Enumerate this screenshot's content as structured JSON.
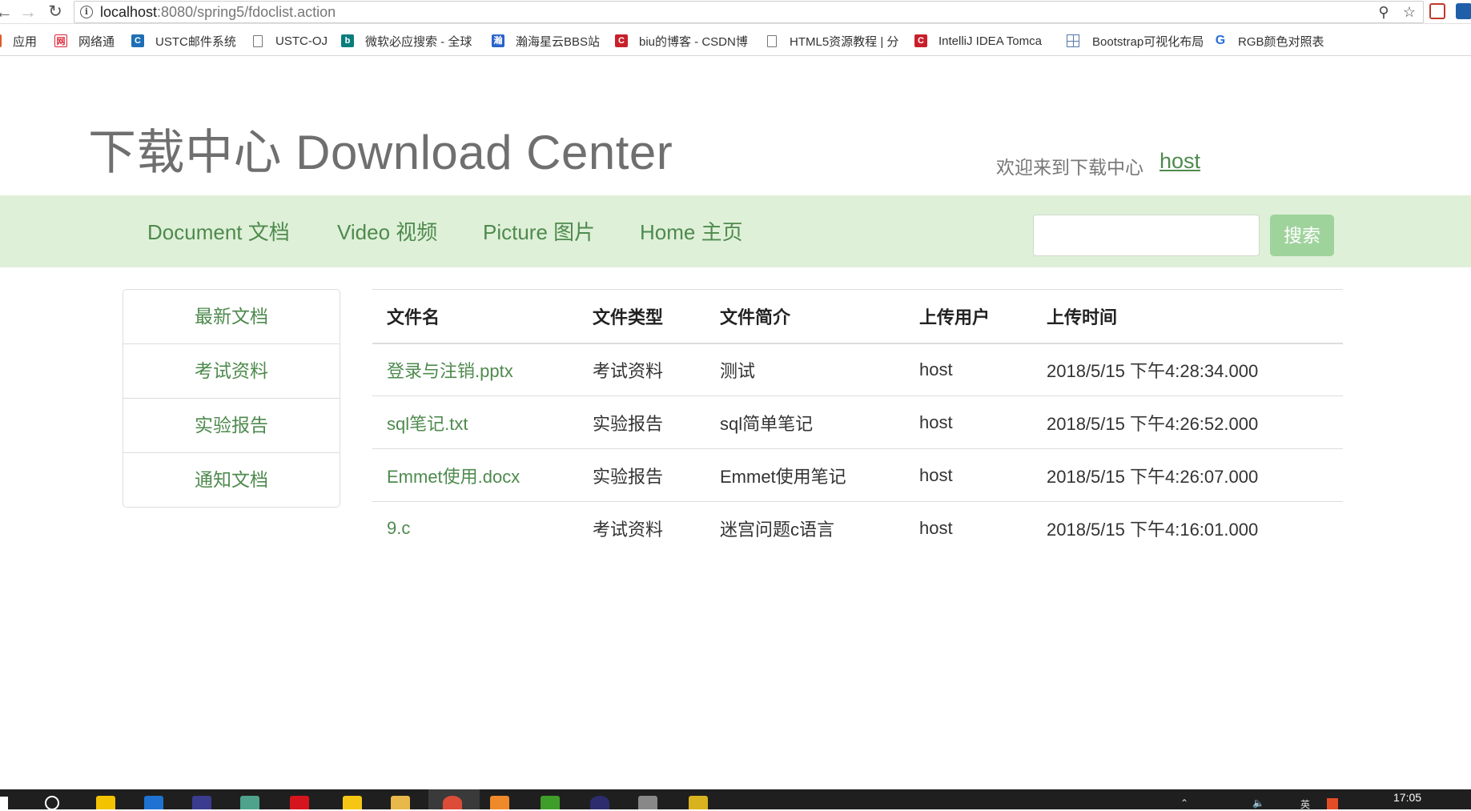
{
  "browser": {
    "url_host": "localhost",
    "url_path": ":8080/spring5/fdoclist.action",
    "bookmarks": [
      {
        "label": "应用",
        "icon": "apps-grid-icon",
        "color": "#e05a2a"
      },
      {
        "label": "网络通",
        "icon": "net-icon",
        "color": "#d23"
      },
      {
        "label": "USTC邮件系统",
        "icon": "ustc-mail-icon",
        "color": "#1e6fb5"
      },
      {
        "label": "USTC-OJ",
        "icon": "page-icon",
        "color": "#777"
      },
      {
        "label": "微软必应搜索 - 全球",
        "icon": "bing-icon",
        "color": "#0a7d7d"
      },
      {
        "label": "瀚海星云BBS站",
        "icon": "bbs-icon",
        "color": "#2a63c9"
      },
      {
        "label": "biu的博客 - CSDN博",
        "icon": "csdn-icon",
        "color": "#c8202b"
      },
      {
        "label": "HTML5资源教程 | 分",
        "icon": "page-icon",
        "color": "#777"
      },
      {
        "label": "IntelliJ IDEA Tomca",
        "icon": "csdn-icon",
        "color": "#c8202b"
      },
      {
        "label": "Bootstrap可视化布局",
        "icon": "grid-icon",
        "color": "#5577aa"
      },
      {
        "label": "RGB颜色对照表",
        "icon": "rgb-icon",
        "color": "#2a6fd6"
      }
    ]
  },
  "header": {
    "title": "下载中心 Download Center",
    "welcome": "欢迎来到下载中心",
    "user": "host"
  },
  "navbar": {
    "items": [
      "Document 文档",
      "Video 视频",
      "Picture 图片",
      "Home 主页"
    ],
    "search_placeholder": "",
    "search_button": "搜索"
  },
  "sidebar": {
    "items": [
      "最新文档",
      "考试资料",
      "实验报告",
      "通知文档"
    ]
  },
  "table": {
    "columns": [
      "文件名",
      "文件类型",
      "文件简介",
      "上传用户",
      "上传时间"
    ],
    "rows": [
      [
        "登录与注销.pptx",
        "考试资料",
        "测试",
        "host",
        "2018/5/15 下午4:28:34.000"
      ],
      [
        "sql笔记.txt",
        "实验报告",
        "sql简单笔记",
        "host",
        "2018/5/15 下午4:26:52.000"
      ],
      [
        "Emmet使用.docx",
        "实验报告",
        "Emmet使用笔记",
        "host",
        "2018/5/15 下午4:26:07.000"
      ],
      [
        "9.c",
        "考试资料",
        "迷宫问题c语言",
        "host",
        "2018/5/15 下午4:16:01.000"
      ]
    ]
  },
  "taskbar": {
    "time": "17:05",
    "ime": "英"
  },
  "colors": {
    "accent_green": "#4e8a4e",
    "navbar_bg": "#dff0d8",
    "search_button_bg": "#9fd39c"
  }
}
